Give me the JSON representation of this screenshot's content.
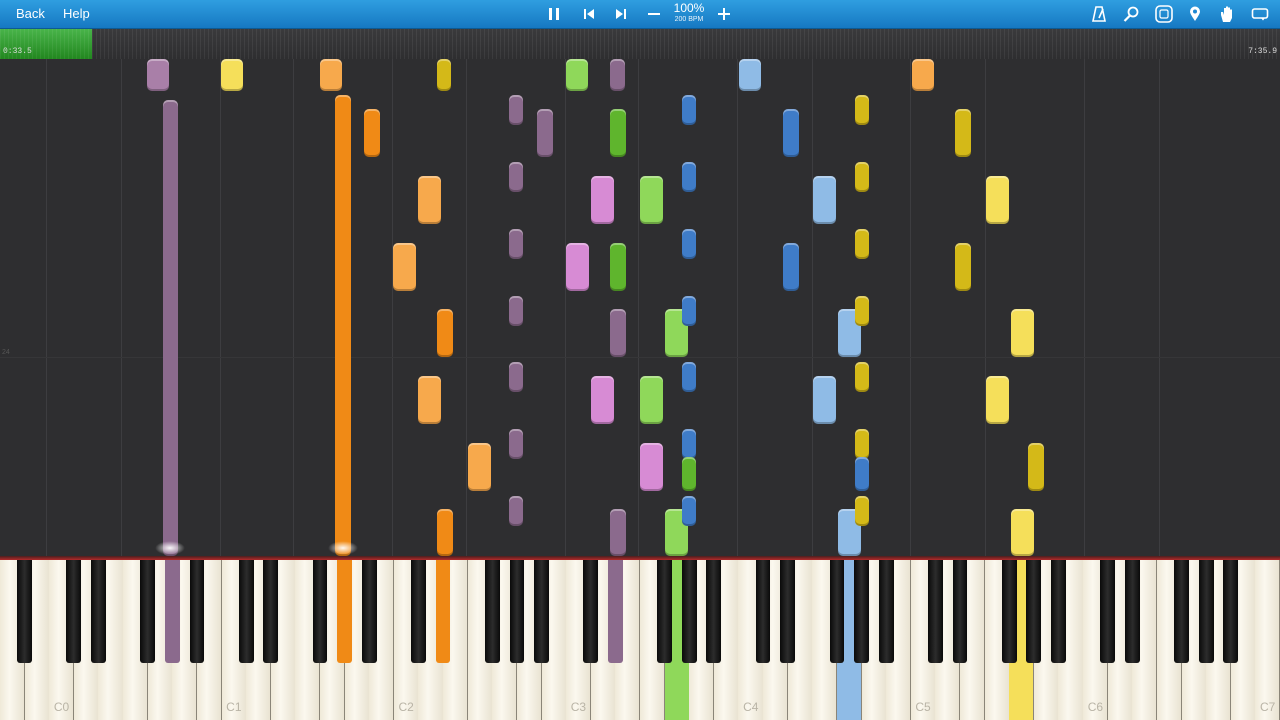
{
  "toolbar": {
    "back_label": "Back",
    "help_label": "Help",
    "tempo_percent": "100%",
    "tempo_bpm": "200 BPM",
    "icons": [
      "pause-icon",
      "previous-icon",
      "next-icon",
      "minus-icon",
      "plus-icon",
      "metronome-icon",
      "search-icon",
      "keyboard-icon",
      "marker-icon",
      "hand-icon",
      "loop-icon"
    ]
  },
  "timeline": {
    "elapsed": "0:33.5",
    "total": "7:35.9",
    "progress_fraction": 0.072
  },
  "roll": {
    "measure_label": "24"
  },
  "keyboard": {
    "octave_labels": [
      "C0",
      "C1",
      "C2",
      "C3",
      "C4",
      "C5",
      "C6",
      "C7"
    ]
  },
  "colors": {
    "purple": "#a97fa8",
    "purple_dark": "#8b6a8d",
    "pink": "#d78bd4",
    "yellow": "#f5df5a",
    "yellow_dark": "#d4b918",
    "orange": "#f7a94c",
    "orange_dark": "#f08a16",
    "green": "#8fd85a",
    "green_dark": "#5fb52d",
    "blue": "#8fbbe6",
    "blue_dark": "#3f7cc8",
    "accent": "#1e88d3"
  }
}
